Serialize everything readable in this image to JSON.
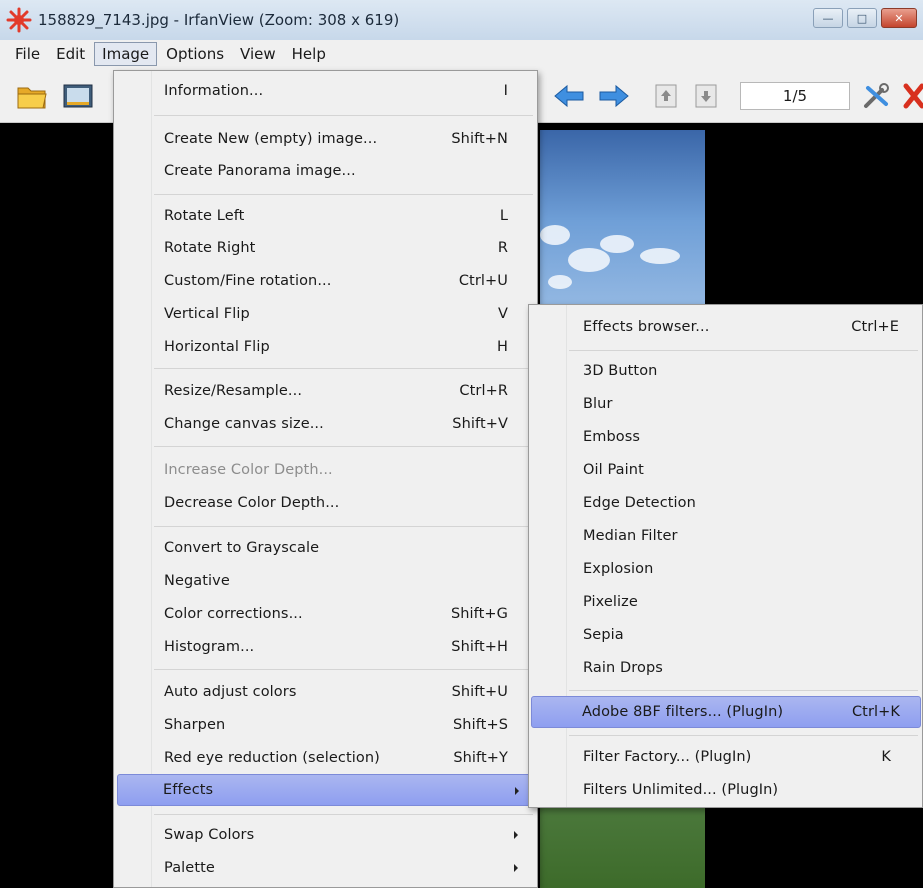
{
  "window": {
    "title": "158829_7143.jpg - IrfanView (Zoom: 308 x 619)",
    "controls": {
      "minimize": "—",
      "maximize": "□",
      "close": "✕"
    }
  },
  "menubar": {
    "items": [
      "File",
      "Edit",
      "Image",
      "Options",
      "View",
      "Help"
    ],
    "active": "Image"
  },
  "toolbar": {
    "page_indicator": "1/5",
    "icons": [
      "open-folder-icon",
      "slideshow-icon",
      "arrow-left-icon",
      "arrow-right-icon",
      "first-page-icon",
      "last-page-icon",
      "settings-icon",
      "exit-icon"
    ]
  },
  "image_menu": {
    "items": [
      {
        "label": "Information...",
        "shortcut": "I",
        "disabled": false
      },
      {
        "label": "Create New (empty) image...",
        "shortcut": "Shift+N",
        "disabled": false
      },
      {
        "label": "Create Panorama image...",
        "shortcut": "",
        "disabled": false
      },
      {
        "label": "Rotate Left",
        "shortcut": "L",
        "disabled": false
      },
      {
        "label": "Rotate Right",
        "shortcut": "R",
        "disabled": false
      },
      {
        "label": "Custom/Fine rotation...",
        "shortcut": "Ctrl+U",
        "disabled": false
      },
      {
        "label": "Vertical Flip",
        "shortcut": "V",
        "disabled": false
      },
      {
        "label": "Horizontal Flip",
        "shortcut": "H",
        "disabled": false
      },
      {
        "label": "Resize/Resample...",
        "shortcut": "Ctrl+R",
        "disabled": false
      },
      {
        "label": "Change canvas size...",
        "shortcut": "Shift+V",
        "disabled": false
      },
      {
        "label": "Increase Color Depth...",
        "shortcut": "",
        "disabled": true
      },
      {
        "label": "Decrease Color Depth...",
        "shortcut": "",
        "disabled": false
      },
      {
        "label": "Convert to Grayscale",
        "shortcut": "",
        "disabled": false
      },
      {
        "label": "Negative",
        "shortcut": "",
        "disabled": false
      },
      {
        "label": "Color corrections...",
        "shortcut": "Shift+G",
        "disabled": false
      },
      {
        "label": "Histogram...",
        "shortcut": "Shift+H",
        "disabled": false
      },
      {
        "label": "Auto adjust colors",
        "shortcut": "Shift+U",
        "disabled": false
      },
      {
        "label": "Sharpen",
        "shortcut": "Shift+S",
        "disabled": false
      },
      {
        "label": "Red eye reduction (selection)",
        "shortcut": "Shift+Y",
        "disabled": false
      },
      {
        "label": "Effects",
        "shortcut": "",
        "disabled": false,
        "submenu": true,
        "highlighted": true
      },
      {
        "label": "Swap Colors",
        "shortcut": "",
        "disabled": false,
        "submenu": true
      },
      {
        "label": "Palette",
        "shortcut": "",
        "disabled": false,
        "submenu": true
      }
    ]
  },
  "effects_menu": {
    "items": [
      {
        "label": "Effects browser...",
        "shortcut": "Ctrl+E"
      },
      {
        "label": "3D Button",
        "shortcut": ""
      },
      {
        "label": "Blur",
        "shortcut": ""
      },
      {
        "label": "Emboss",
        "shortcut": ""
      },
      {
        "label": "Oil Paint",
        "shortcut": ""
      },
      {
        "label": "Edge Detection",
        "shortcut": ""
      },
      {
        "label": "Median Filter",
        "shortcut": ""
      },
      {
        "label": "Explosion",
        "shortcut": ""
      },
      {
        "label": "Pixelize",
        "shortcut": ""
      },
      {
        "label": "Sepia",
        "shortcut": ""
      },
      {
        "label": "Rain Drops",
        "shortcut": ""
      },
      {
        "label": "Adobe 8BF filters... (PlugIn)",
        "shortcut": "Ctrl+K",
        "highlighted": true
      },
      {
        "label": "Filter Factory... (PlugIn)",
        "shortcut": "K"
      },
      {
        "label": "Filters Unlimited... (PlugIn)",
        "shortcut": ""
      }
    ]
  },
  "colors": {
    "highlight": "#8e9ef0",
    "menu_bg": "#f0f0f0",
    "disabled_text": "#8d8d8d"
  }
}
